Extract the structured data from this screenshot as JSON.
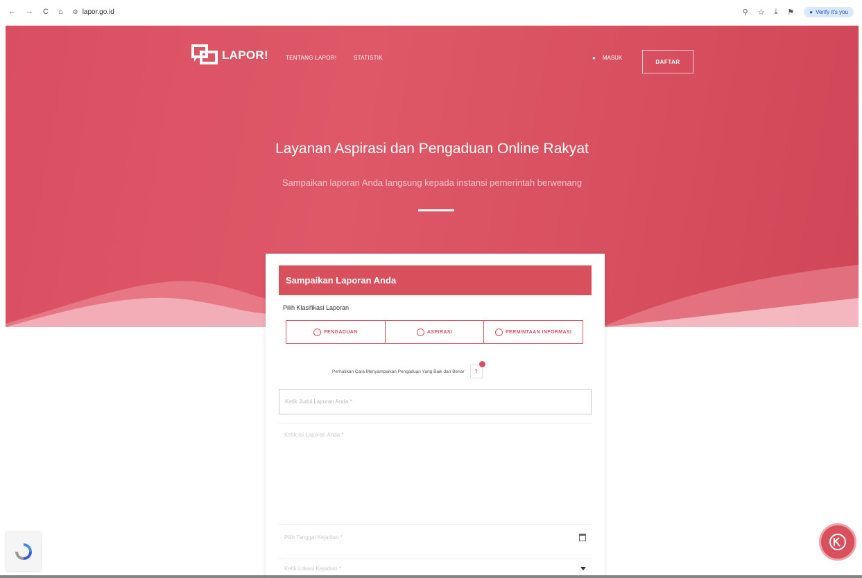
{
  "browser": {
    "url": "lapor.go.id",
    "verify_label": "Verify it's you"
  },
  "nav": {
    "logo_text": "LAPOR!",
    "links": [
      "TENTANG LAPOR!",
      "STATISTIK"
    ],
    "masuk": "MASUK",
    "daftar": "DAFTAR"
  },
  "hero": {
    "title": "Layanan Aspirasi dan Pengaduan Online Rakyat",
    "subtitle": "Sampaikan laporan Anda langsung kepada instansi pemerintah berwenang"
  },
  "form": {
    "header": "Sampaikan Laporan Anda",
    "klasifikasi_label": "Pilih Klasifikasi Laporan",
    "klasifikasi_options": [
      "PENGADUAN",
      "ASPIRASI",
      "PERMINTAAN INFORMASI"
    ],
    "notice": "Perhatikan Cara Menyampaikan Pengaduan Yang Baik dan Benar",
    "notice_btn": "?",
    "judul_placeholder": "Ketik Judul Laporan Anda *",
    "isi_placeholder": "Ketik Isi Laporan Anda *",
    "tanggal_placeholder": "Pilih Tanggal Kejadian *",
    "lokasi_placeholder": "Ketik Lokasi Kejadian *"
  },
  "colors": {
    "brand": "#d9505d",
    "hero_bg": "#dc5566"
  }
}
